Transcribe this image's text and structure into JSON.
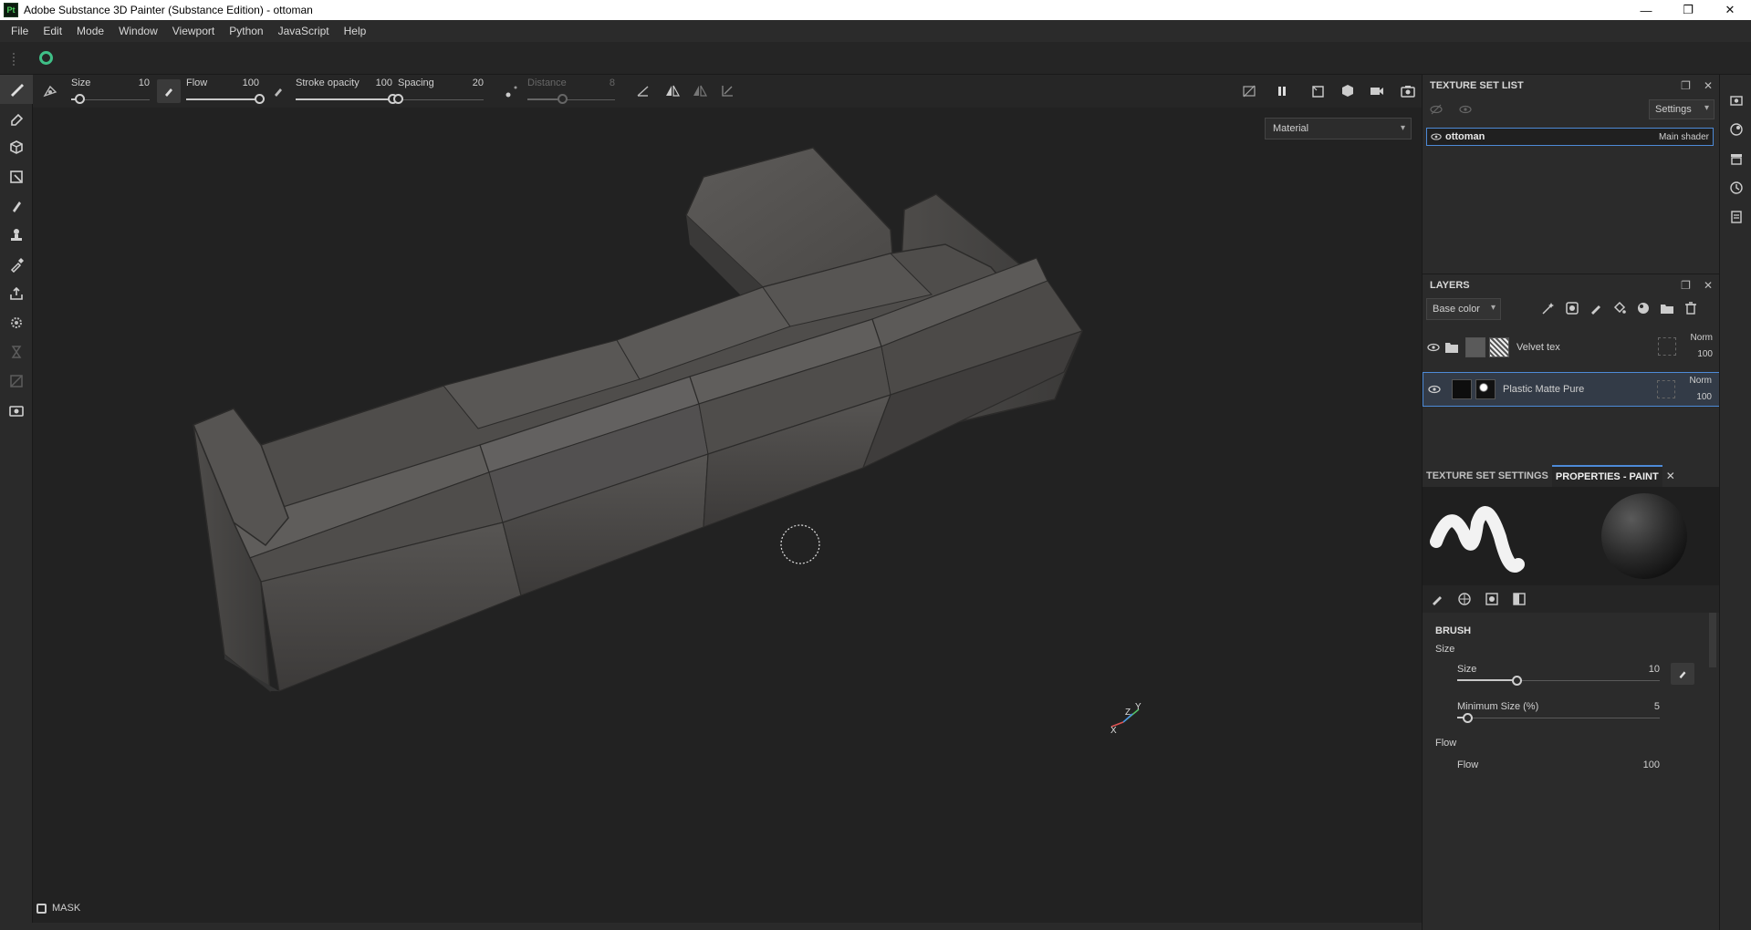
{
  "window": {
    "app_icon_text": "Pt",
    "title": "Adobe Substance 3D Painter (Substance Edition) - ottoman",
    "minimize": "—",
    "maximize": "❐",
    "close": "✕"
  },
  "menu": [
    "File",
    "Edit",
    "Mode",
    "Window",
    "Viewport",
    "Python",
    "JavaScript",
    "Help"
  ],
  "brush_toolbar": {
    "size": {
      "label": "Size",
      "value": "10",
      "fraction": 0.1
    },
    "flow": {
      "label": "Flow",
      "value": "100",
      "fraction": 1.0
    },
    "stroke_opacity": {
      "label": "Stroke opacity",
      "value": "100",
      "fraction": 1.0
    },
    "spacing": {
      "label": "Spacing",
      "value": "20",
      "fraction": 0.0
    },
    "distance": {
      "label": "Distance",
      "value": "8",
      "fraction": 0.4
    }
  },
  "viewport": {
    "channel_select": "Material",
    "mask_label": "MASK",
    "axis_labels": {
      "z": "Z",
      "y": "Y",
      "x": "X"
    }
  },
  "texture_set_list": {
    "title": "TEXTURE SET LIST",
    "settings_label": "Settings",
    "items": [
      {
        "name": "ottoman",
        "shader": "Main shader"
      }
    ]
  },
  "layers": {
    "title": "LAYERS",
    "channel": "Base color",
    "items": [
      {
        "name": "Velvet tex",
        "blend": "Norm",
        "opacity": "100",
        "type": "folder"
      },
      {
        "name": "Plastic Matte Pure",
        "blend": "Norm",
        "opacity": "100",
        "type": "fill",
        "selected": true
      }
    ]
  },
  "properties": {
    "tabs": [
      "TEXTURE SET SETTINGS",
      "PROPERTIES - PAINT"
    ],
    "active_tab": "PROPERTIES - PAINT",
    "section": "BRUSH",
    "size_group": "Size",
    "size": {
      "label": "Size",
      "value": "10",
      "fraction": 0.3
    },
    "min_size": {
      "label": "Minimum Size (%)",
      "value": "5",
      "fraction": 0.05
    },
    "flow_group": "Flow",
    "flow": {
      "label": "Flow",
      "value": "100",
      "fraction": 1.0
    }
  },
  "colors": {
    "accent": "#4d8ad7",
    "viewport_bg": "#222222",
    "panel_bg": "#2b2b2b"
  }
}
